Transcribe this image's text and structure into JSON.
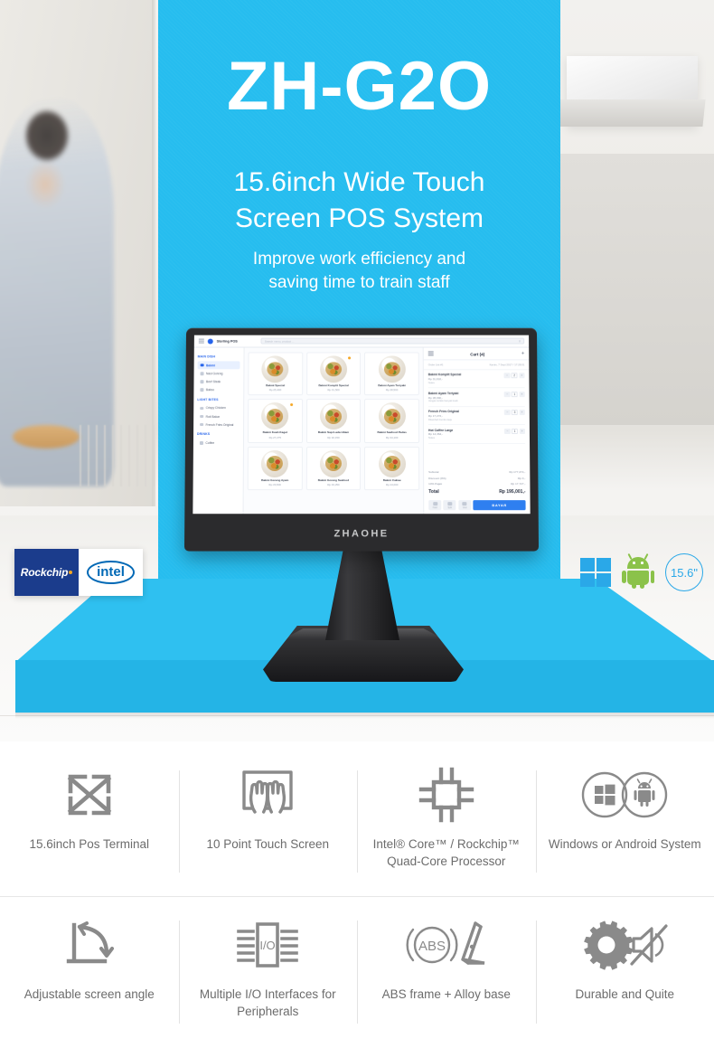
{
  "hero": {
    "headline": "ZH-G2O",
    "subhead_line1": "15.6inch Wide Touch",
    "subhead_line2": "Screen POS System",
    "tagline_line1": "Improve work efficiency and",
    "tagline_line2": "saving time to train staff",
    "brand_on_bezel": "ZHAOHE",
    "accent_color": "#26bdef",
    "panel_color": "#2fc0f0"
  },
  "logos": {
    "rockchip": "Rockchip",
    "intel": "intel",
    "rockchip_bg": "#1b3c8c",
    "intel_fg": "#0068b5"
  },
  "os_badges": {
    "windows_icon": "windows-logo-icon",
    "android_icon": "android-robot-icon",
    "size_label": "15.6\"",
    "windows_color": "#2aa8e8",
    "android_color": "#8bc24a",
    "badge_color": "#2aa8e8"
  },
  "pos": {
    "app_title": "Sterling POS",
    "search_placeholder": "Search menu, product ...",
    "menu_icon": "hamburger-menu-icon",
    "search_icon": "search-icon",
    "sidebar": [
      {
        "type": "header",
        "label": "MAIN DISH"
      },
      {
        "type": "item",
        "label": "Bakmi",
        "active": true
      },
      {
        "type": "item",
        "label": "Nasi Goreng",
        "active": false
      },
      {
        "type": "item",
        "label": "Beef Steak",
        "active": false
      },
      {
        "type": "item",
        "label": "Bakso",
        "active": false
      },
      {
        "type": "header",
        "label": "LIGHT BITES"
      },
      {
        "type": "item",
        "label": "Crispy Chicken",
        "active": false
      },
      {
        "type": "item",
        "label": "Roti Bakar",
        "active": false
      },
      {
        "type": "item",
        "label": "French Fries Original",
        "active": false
      },
      {
        "type": "header",
        "label": "DRINKS"
      },
      {
        "type": "item",
        "label": "Coffee",
        "active": false
      }
    ],
    "products": [
      {
        "name": "Bakmi Special",
        "price": "Rp 25,400",
        "badge": false
      },
      {
        "name": "Bakmi Komplit Special",
        "price": "Rp 31,500",
        "badge": true
      },
      {
        "name": "Bakmi Ayam Teriyaki",
        "price": "Rp 28,500",
        "badge": false
      },
      {
        "name": "Bakmi Kuah Kaget",
        "price": "Rp 27,275",
        "badge": true
      },
      {
        "name": "Bakmi Sapi Lada Hitam",
        "price": "Rp 32,150",
        "badge": false
      },
      {
        "name": "Bakmi Seafood Pedas",
        "price": "Rp 34,100",
        "badge": false
      },
      {
        "name": "Bakmi Goreng Ayam",
        "price": "Rp 26,500",
        "badge": false
      },
      {
        "name": "Bakmi Goreng Seafood",
        "price": "Rp 33,250",
        "badge": false
      },
      {
        "name": "Bakmi Cakwe",
        "price": "Rp 24,000",
        "badge": false
      }
    ],
    "cart": {
      "title": "Cart (4)",
      "list_icon": "list-icon",
      "add_icon": "plus-icon",
      "order_label": "Order List #1",
      "order_datetime": "Kamis, 7 Sept 2017 / 17:28:01",
      "items": [
        {
          "name": "Bakmi Komplit Special",
          "price": "Rp 31,818,-",
          "note": "Notes",
          "qty": "2"
        },
        {
          "name": "Bakmi Ayam Teriyaki",
          "price": "Rp 28,090,-",
          "note": "Jangan terlalu banyak kuah",
          "qty": "1"
        },
        {
          "name": "French Fries Original",
          "price": "Rp 17,272,-",
          "note": "Ditambah bumbu keju",
          "qty": "3"
        },
        {
          "name": "Hot Coffee Large",
          "price": "Rp 14,364,-",
          "note": "Notes",
          "qty": "1"
        }
      ],
      "summary": [
        {
          "label": "Subtotal",
          "value": "Rp 177,274,-"
        },
        {
          "label": "Discount (0%)",
          "value": "Rp 0,-"
        },
        {
          "label": "10% Pajak",
          "value": "Rp 17,727,-"
        }
      ],
      "total_label": "Total",
      "total_value": "Rp 195,001,-",
      "footer_buttons": [
        {
          "label": "Hold",
          "icon": "pause-icon"
        },
        {
          "label": "Split",
          "icon": "split-icon"
        },
        {
          "label": "Void",
          "icon": "trash-icon"
        }
      ],
      "pay_button": "BAYAR"
    }
  },
  "features": [
    {
      "icon": "resize-diagonal-arrows-icon",
      "label": "15.6inch Pos Terminal"
    },
    {
      "icon": "ten-point-touch-hands-icon",
      "label": "10 Point Touch\nScreen"
    },
    {
      "icon": "cpu-chip-icon",
      "label": "Intel® Core™ / Rockchip™\nQuad-Core Processor"
    },
    {
      "icon": "windows-android-circles-icon",
      "label": "Windows or Android System"
    },
    {
      "icon": "adjustable-angle-arrow-icon",
      "label": "Adjustable screen angle"
    },
    {
      "icon": "io-ports-icon",
      "label": "Multiple I/O Interfaces\nfor Peripherals"
    },
    {
      "icon": "abs-frame-stand-icon",
      "label": "ABS frame + Alloy base"
    },
    {
      "icon": "gear-mute-speaker-icon",
      "label": "Durable and Quite"
    }
  ]
}
